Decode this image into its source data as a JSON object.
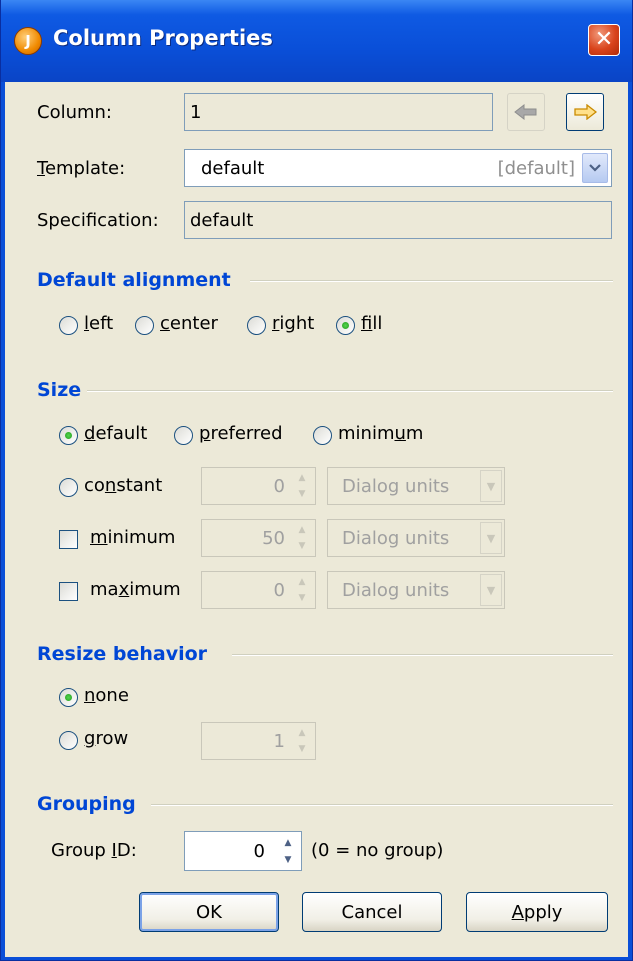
{
  "window": {
    "title": "Column Properties",
    "app_icon_letter": "J",
    "close_glyph": "✕"
  },
  "column": {
    "label": "Column:",
    "value": "1"
  },
  "template": {
    "label_mnemonic": "T",
    "label_rest": "emplate:",
    "value": "default",
    "hint": "[default]"
  },
  "specification": {
    "label": "Specification:",
    "value": "default"
  },
  "alignment": {
    "heading": "Default alignment",
    "options": [
      {
        "mn": "l",
        "rest": "eft",
        "selected": false
      },
      {
        "mn": "c",
        "rest": "enter",
        "selected": false
      },
      {
        "pre": "",
        "mn": "r",
        "rest": "ight",
        "selected": false
      },
      {
        "mn": "f",
        "rest": "ill",
        "selected": true
      }
    ]
  },
  "size": {
    "heading": "Size",
    "options": {
      "default": {
        "mn": "d",
        "rest": "efault",
        "selected": true
      },
      "preferred": {
        "mn": "p",
        "rest": "referred",
        "selected": false
      },
      "minimum": {
        "pre": "minim",
        "mn": "u",
        "rest": "m",
        "selected": false
      }
    },
    "constant": {
      "pre": "co",
      "mn": "n",
      "rest": "stant",
      "value": "0",
      "unit": "Dialog units"
    },
    "min": {
      "mn": "m",
      "rest": "inimum",
      "value": "50",
      "unit": "Dialog units",
      "checked": false
    },
    "max": {
      "pre": "ma",
      "mn": "x",
      "rest": "imum",
      "value": "0",
      "unit": "Dialog units",
      "checked": false
    }
  },
  "resize": {
    "heading": "Resize behavior",
    "none": {
      "mn": "n",
      "rest": "one",
      "selected": true
    },
    "grow": {
      "mn": "g",
      "rest": "row",
      "selected": false,
      "value": "1"
    }
  },
  "grouping": {
    "heading": "Grouping",
    "label_pre": "Group ",
    "label_mn": "I",
    "label_rest": "D:",
    "value": "0",
    "note": "(0 = no group)"
  },
  "buttons": {
    "ok": "OK",
    "cancel": "Cancel",
    "apply_mn": "A",
    "apply_rest": "pply"
  },
  "colors": {
    "title_bar": "#0a4fd8",
    "section_heading": "#0046d5",
    "dialog_background": "#ece9d8",
    "radio_selected": "#2aa525",
    "next_arrow": "#f2a72b"
  }
}
